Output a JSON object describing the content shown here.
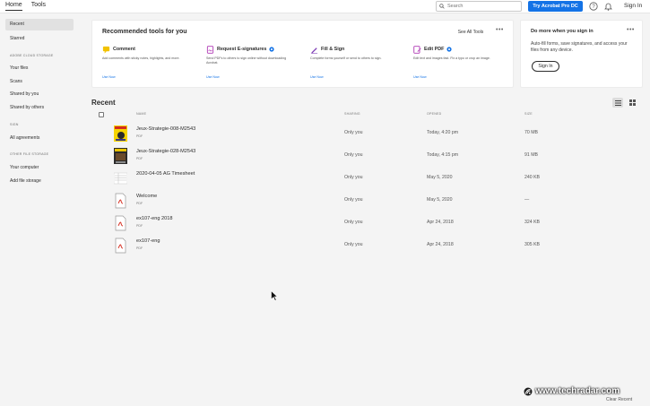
{
  "topbar": {
    "tabs": [
      {
        "label": "Home"
      },
      {
        "label": "Tools"
      }
    ],
    "search_placeholder": "Search",
    "try_button": "Try Acrobat Pro DC",
    "sign_in": "Sign In"
  },
  "sidebar": {
    "recent": "Recent",
    "starred": "Starred",
    "adobe_cloud_heading": "ADOBE CLOUD STORAGE",
    "your_files": "Your files",
    "scans": "Scans",
    "shared_by_you": "Shared by you",
    "shared_by_others": "Shared by others",
    "sign_heading": "SIGN",
    "all_agreements": "All agreements",
    "other_storage_heading": "OTHER FILE STORAGE",
    "your_computer": "Your computer",
    "add_file_storage": "Add file storage"
  },
  "recommended": {
    "title": "Recommended tools for you",
    "see_all": "See All Tools",
    "tools": [
      {
        "name": "Comment",
        "desc": "Add comments with sticky notes, highlights, and more.",
        "link": "Use Now",
        "color": "#f2c200"
      },
      {
        "name": "Request E-signatures",
        "desc": "Send PDFs to others to sign online without downloading Acrobat.",
        "link": "Use Now",
        "color": "#b03ab5"
      },
      {
        "name": "Fill & Sign",
        "desc": "Complete forms yourself or send to others to sign.",
        "link": "Use Now",
        "color": "#7b3ab5"
      },
      {
        "name": "Edit PDF",
        "desc": "Edit text and images fast. Fix a typo or crop an image.",
        "link": "Use Now",
        "color": "#b03ab5"
      }
    ]
  },
  "signin_panel": {
    "title": "Do more when you sign in",
    "desc": "Auto-fill forms, save signatures, and access your files from any device.",
    "button": "Sign In"
  },
  "recent": {
    "title": "Recent",
    "columns": {
      "name": "NAME",
      "sharing": "SHARING",
      "opened": "OPENED",
      "size": "SIZE"
    },
    "rows": [
      {
        "name": "Jeux-Strategie-008-M2543",
        "type": "PDF",
        "sharing": "Only you",
        "opened": "Today, 4:20 pm",
        "size": "70 MB",
        "thumb": "cover-yellow"
      },
      {
        "name": "Jeux-Strategie-028-M2543",
        "type": "PDF",
        "sharing": "Only you",
        "opened": "Today, 4:15 pm",
        "size": "91 MB",
        "thumb": "cover-dark"
      },
      {
        "name": "2020-04-05 AG Timesheet",
        "type": "",
        "sharing": "Only you",
        "opened": "May 5, 2020",
        "size": "240 KB",
        "thumb": "sheet"
      },
      {
        "name": "Welcome",
        "type": "PDF",
        "sharing": "Only you",
        "opened": "May 5, 2020",
        "size": "—",
        "thumb": "pdf"
      },
      {
        "name": "ex107-eng 2018",
        "type": "PDF",
        "sharing": "Only you",
        "opened": "Apr 24, 2018",
        "size": "324 KB",
        "thumb": "pdf"
      },
      {
        "name": "ex107-eng",
        "type": "PDF",
        "sharing": "Only you",
        "opened": "Apr 24, 2018",
        "size": "305 KB",
        "thumb": "pdf"
      }
    ]
  },
  "footer": {
    "brand": "www.techradar.com",
    "clear_recent": "Clear Recent"
  }
}
